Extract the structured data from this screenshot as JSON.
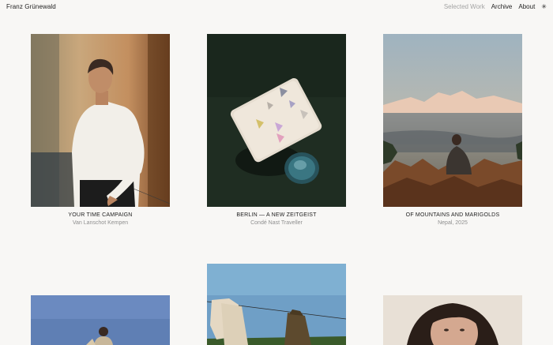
{
  "site": {
    "brand": "Franz Grünewald",
    "nav": [
      {
        "label": "Selected Work",
        "active": false
      },
      {
        "label": "Archive",
        "active": true
      },
      {
        "label": "About",
        "active": true
      }
    ],
    "theme_icon": "sun-icon"
  },
  "projects": [
    {
      "title": "YOUR TIME CAMPAIGN",
      "subtitle": "Van Lanschot Kempen"
    },
    {
      "title": "BERLIN — A NEW ZEITGEIST",
      "subtitle": "Condé Nast Traveller"
    },
    {
      "title": "OF MOUNTAINS AND MARIGOLDS",
      "subtitle": "Nepal, 2025"
    }
  ],
  "colors": {
    "background": "#f8f7f5",
    "text": "#1e1e1e",
    "muted": "#a3a3a3"
  }
}
